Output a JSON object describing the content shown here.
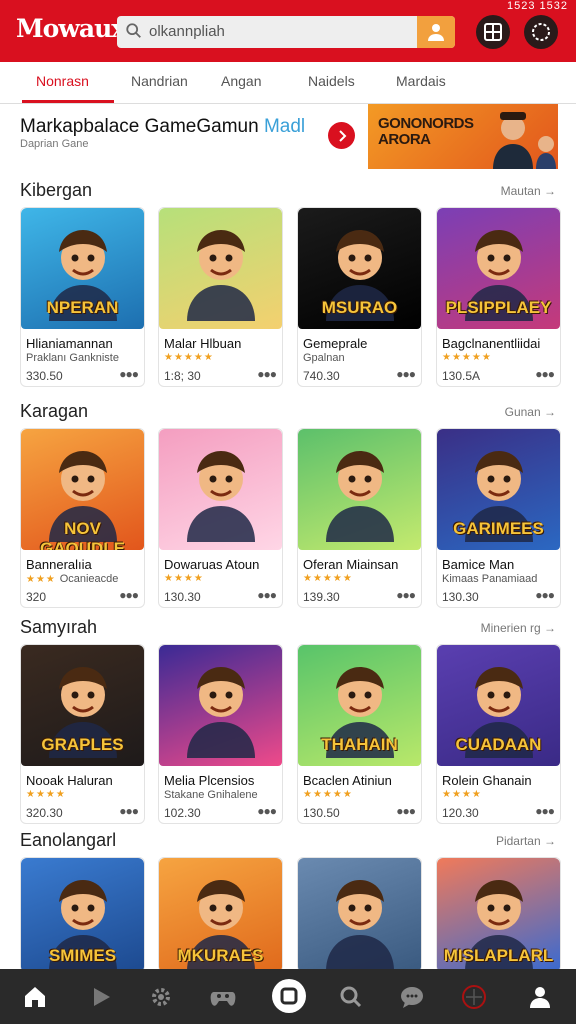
{
  "status_bar": {
    "time": "1523 1532"
  },
  "header": {
    "logo": "Mowaux",
    "search_placeholder": "olkannpliah"
  },
  "tabs": [
    "Nonrasn",
    "Nandrian",
    "Angan",
    "Naidels",
    "Mardais"
  ],
  "promo": {
    "title_main": "Markapbalace GameGamun",
    "title_accent": "Madl",
    "subtitle": "Daprian Gane",
    "banner_text": "GONONORDS ARORA"
  },
  "sections": [
    {
      "title": "Kibergan",
      "more": "Mautan",
      "cards": [
        {
          "name": "Hlianiamannan",
          "sub": "Praklanı Gankniste",
          "price": "330.50",
          "img_text": "NPERAN",
          "colors": [
            "#3fb6e8",
            "#1d6fb0"
          ]
        },
        {
          "name": "Malar Hlbuan",
          "stars": "★★★★★",
          "price": "1:8; 30",
          "img_text": "",
          "colors": [
            "#b6e07a",
            "#f4d06f"
          ]
        },
        {
          "name": "Gemeprale",
          "sub": "Gpalnan",
          "price": "740.30",
          "img_text": "MSURAO",
          "colors": [
            "#1b1b1b",
            "#000000"
          ]
        },
        {
          "name": "Bagclnanentliidai",
          "stars": "★★★★★",
          "price": "130.5A",
          "img_text": "PLSIPPLAEY",
          "colors": [
            "#7b3fb5",
            "#c53a7a"
          ]
        }
      ]
    },
    {
      "title": "Karagan",
      "more": "Gunan",
      "cards": [
        {
          "name": "Banneralıia",
          "stars": "★★★",
          "stars_text": "Ocanieacde",
          "price": "320",
          "img_text": "NOV GAOUDLE",
          "colors": [
            "#f6a441",
            "#e2561c"
          ]
        },
        {
          "name": "Dowaruas Atoun",
          "stars": "★★★★",
          "price": "130.30",
          "img_text": "",
          "colors": [
            "#f49ec0",
            "#ffd6e6"
          ]
        },
        {
          "name": "Oferan Miainsan",
          "stars": "★★★★★",
          "price": "139.30",
          "img_text": "",
          "colors": [
            "#5cc06b",
            "#c4ea6e"
          ]
        },
        {
          "name": "Bamice Man",
          "sub": "Kimaas Panamiaad",
          "price": "130.30",
          "img_text": "GARIMEES",
          "colors": [
            "#3a2f86",
            "#2b68c2"
          ]
        }
      ]
    },
    {
      "title": "Samyırah",
      "more": "Minerien rg",
      "cards": [
        {
          "name": "Nooak Haluran",
          "stars": "★★★★",
          "price": "320.30",
          "img_text": "GRAPLES",
          "colors": [
            "#3a2a20",
            "#1e1a1a"
          ]
        },
        {
          "name": "Melia Plcensios",
          "sub": "Stakane Gnihalene",
          "price": "102.30",
          "img_text": "",
          "colors": [
            "#3a2a95",
            "#ef4a8a"
          ]
        },
        {
          "name": "Bcaclen Atiniun",
          "stars": "★★★★★",
          "price": "130.50",
          "img_text": "THAHAIN",
          "colors": [
            "#58c46a",
            "#b9e86a"
          ]
        },
        {
          "name": "Rolein Ghanain",
          "stars": "★★★★",
          "price": "120.30",
          "img_text": "CUADAAN",
          "colors": [
            "#5a3fb0",
            "#3a2a86"
          ]
        }
      ]
    },
    {
      "title": "Eanolangarl",
      "more": "Pidartan",
      "cards": [
        {
          "img_text": "SMIMES",
          "colors": [
            "#3a7bd0",
            "#1d4a90"
          ]
        },
        {
          "img_text": "MKURAES",
          "colors": [
            "#f6a441",
            "#e06a1c"
          ]
        },
        {
          "img_text": "",
          "colors": [
            "#6a8ab0",
            "#3a5a80"
          ]
        },
        {
          "img_text": "MISLAPLARL",
          "colors": [
            "#f07a5a",
            "#3a6ad0"
          ]
        }
      ]
    }
  ],
  "bottom_nav": [
    "home-icon",
    "play-icon",
    "gear-icon",
    "gamepad-icon",
    "stop-icon",
    "search-icon",
    "chat-icon",
    "crosshair-icon",
    "profile-icon"
  ],
  "theme": {
    "brand": "#d9101f",
    "nav_bg": "#2a2a2a",
    "star": "#f0a020"
  }
}
